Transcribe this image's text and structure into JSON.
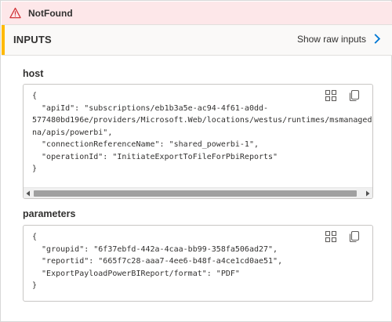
{
  "error": {
    "title": "NotFound",
    "icon": "warning-triangle-icon",
    "color": "#d13438",
    "background": "#fde7e9"
  },
  "inputs_section": {
    "title": "INPUTS",
    "show_raw_label": "Show raw inputs",
    "accent_color": "#ffb900",
    "chevron_color": "#0078d4"
  },
  "host": {
    "label": "host",
    "code": "{\n  \"apiId\": \"subscriptions/eb1b3a5e-ac94-4f61-a0dd-\n577480bd196e/providers/Microsoft.Web/locations/westus/runtimes/msmanaged\nna/apis/powerbi\",\n  \"connectionReferenceName\": \"shared_powerbi-1\",\n  \"operationId\": \"InitiateExportToFileForPbiReports\"\n}"
  },
  "parameters": {
    "label": "parameters",
    "code": "{\n  \"groupid\": \"6f37ebfd-442a-4caa-bb99-358fa506ad27\",\n  \"reportid\": \"665f7c28-aaa7-4ee6-b48f-a4ce1cd0ae51\",\n  \"ExportPayloadPowerBIReport/format\": \"PDF\"\n}"
  },
  "icons": {
    "expand": "expand-grid-icon",
    "copy": "copy-icon"
  }
}
